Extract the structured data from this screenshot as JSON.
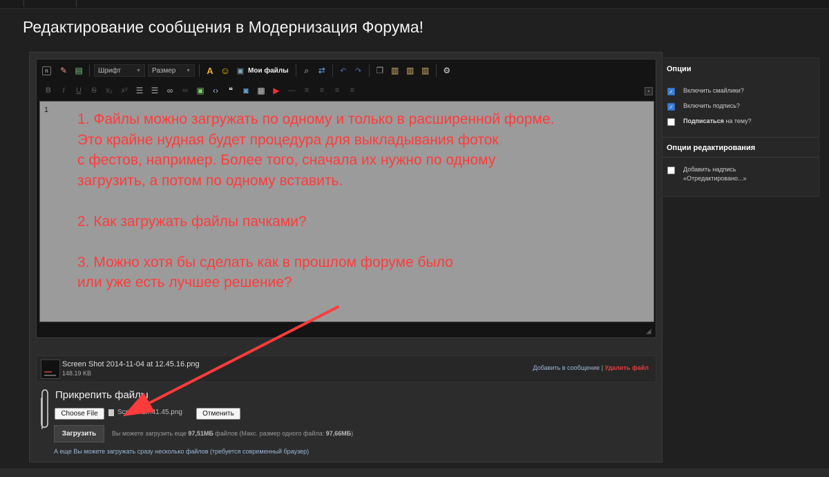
{
  "page": {
    "title": "Редактирование сообщения в Модернизация Форума!"
  },
  "toolbar": {
    "font_label": "Шрифт",
    "size_label": "Размер",
    "my_files_label": "Мои файлы"
  },
  "editor": {
    "line_number": "1",
    "overlay_text": "1. Файлы можно загружать по одному и только в расширенной форме.\nЭто крайне нудная будет процедура для выкладывания фоток\nс фестов, например. Более того, сначала их нужно по одному\nзагрузить, а потом по одному вставить.\n\n2. Как загружать файлы пачками?\n\n3. Можно хотя бы сделать как в прошлом форуме было\nили уже есть лучшее решение?",
    "overlay_color": "#ff3b3b"
  },
  "attached_file": {
    "name": "Screen Shot 2014-11-04 at 12.45.16.png",
    "size": "148.19 KB",
    "add_link": "Добавить в сообщение",
    "separator": "|",
    "delete_link": "Удалить файл"
  },
  "attach": {
    "title": "Прикрепить файлы",
    "choose_button": "Choose File",
    "chosen_file": "Screen S...41.45.png",
    "cancel_button": "Отменить",
    "upload_button": "Загрузить",
    "info_prefix": "Вы можете загрузить еще ",
    "info_size": "97,51МБ",
    "info_middle": " файлов (Макс. размер одного файла: ",
    "info_max": "97,66МБ",
    "info_suffix": ")",
    "multi_note": "А еще Вы можете загружать сразу несколько файлов (требуется современный браузер)"
  },
  "options": {
    "heading": "Опции",
    "items": [
      {
        "label": "Включить смайлики?",
        "checked": true
      },
      {
        "label": "Включить подпись?",
        "checked": true
      },
      {
        "label_bold": "Подписаться",
        "label_rest": " на тему?",
        "checked": false
      }
    ],
    "edit_heading": "Опции редактирования",
    "edit_items": [
      {
        "line1": "Добавить надпись",
        "line2": "«Отредактировано...»",
        "checked": false
      }
    ]
  },
  "colors": {
    "accent_red": "#ff3b3b",
    "checkbox_blue": "#3f7fd6",
    "link_blue": "#9ab8d8"
  }
}
